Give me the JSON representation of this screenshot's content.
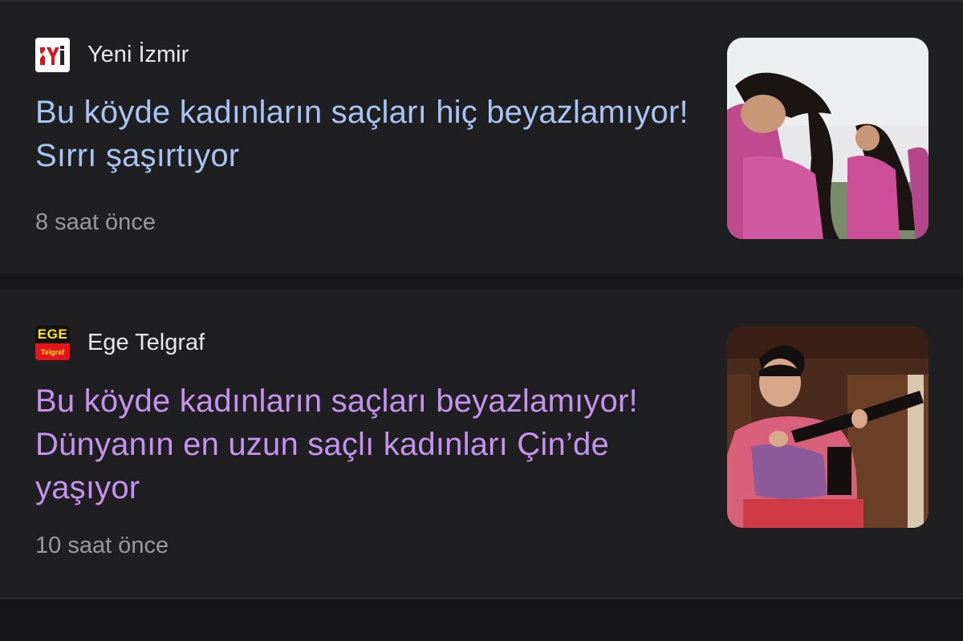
{
  "articles": [
    {
      "source": "Yeni İzmir",
      "logo_text": "YI",
      "headline": "Bu köyde kadınların saçları hiç beyazlamıyor! Sırrı şaşırtıyor",
      "time": "8 saat önce",
      "headline_color": "#a9c3f2",
      "thumbnail_icon": "women-long-hair-photo"
    },
    {
      "source": "Ege Telgraf",
      "logo_text_top": "EGE",
      "logo_text_bottom": "Telgraf",
      "headline": "Bu köyde kadınların saçları beyazlamıyor! Dünyanın en uzun saçlı kadınları Çin’de yaşıyor",
      "time": "10 saat önce",
      "headline_color": "#c593ee",
      "thumbnail_icon": "woman-long-hair-photo"
    }
  ]
}
